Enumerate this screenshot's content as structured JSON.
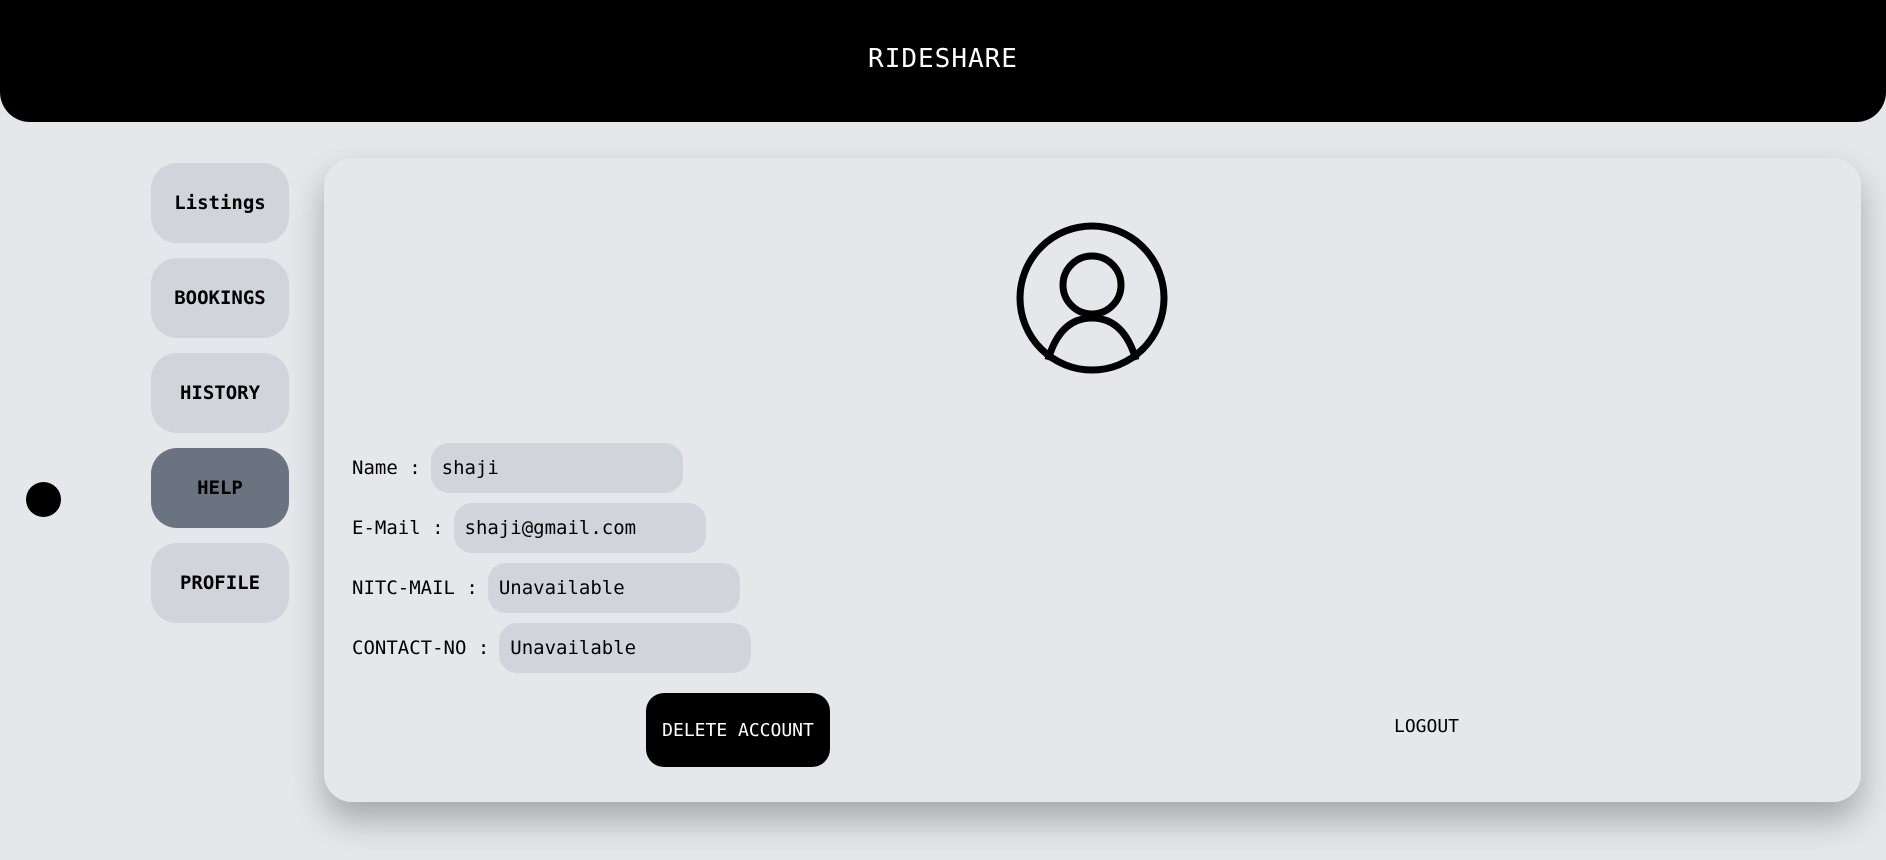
{
  "header": {
    "title": "RIDESHARE",
    "bg_color": "#000000"
  },
  "sidebar": {
    "items": [
      {
        "label": "Listings",
        "active": false
      },
      {
        "label": "BOOKINGS",
        "active": false
      },
      {
        "label": "HISTORY",
        "active": false
      },
      {
        "label": "HELP",
        "active": true
      },
      {
        "label": "PROFILE",
        "active": false
      }
    ],
    "active_color": "#6b7280",
    "item_color": "#d1d5db"
  },
  "profile": {
    "avatar_icon": "user-circle-icon",
    "fields": [
      {
        "label": "Name :",
        "value": "shaji"
      },
      {
        "label": "E-Mail :",
        "value": "shaji@gmail.com"
      },
      {
        "label": "NITC-MAIL :",
        "value": "Unavailable"
      },
      {
        "label": "CONTACT-NO :",
        "value": "Unavailable"
      }
    ],
    "delete_label": "DELETE ACCOUNT",
    "logout_label": "LOGOUT"
  }
}
